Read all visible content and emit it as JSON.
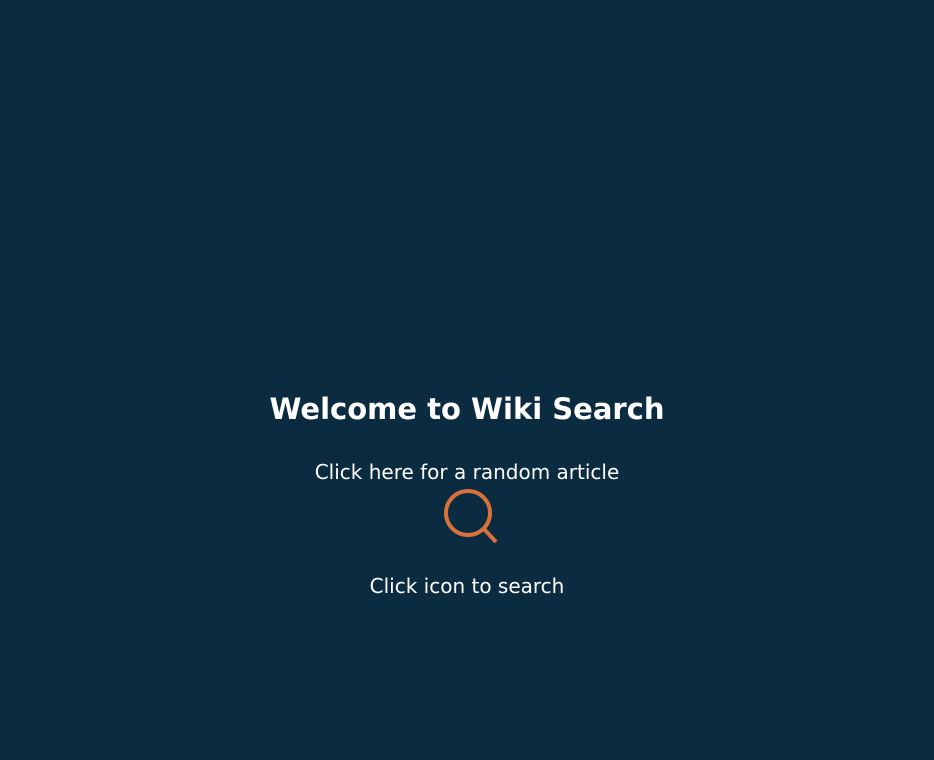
{
  "welcome": {
    "title": "Welcome to Wiki Search",
    "random_link": "Click here for a random article",
    "search_hint": "Click icon to search"
  },
  "colors": {
    "background": "#0a2b40",
    "accent": "#d9713a",
    "text": "#ffffff"
  },
  "icons": {
    "search": "search-icon"
  }
}
